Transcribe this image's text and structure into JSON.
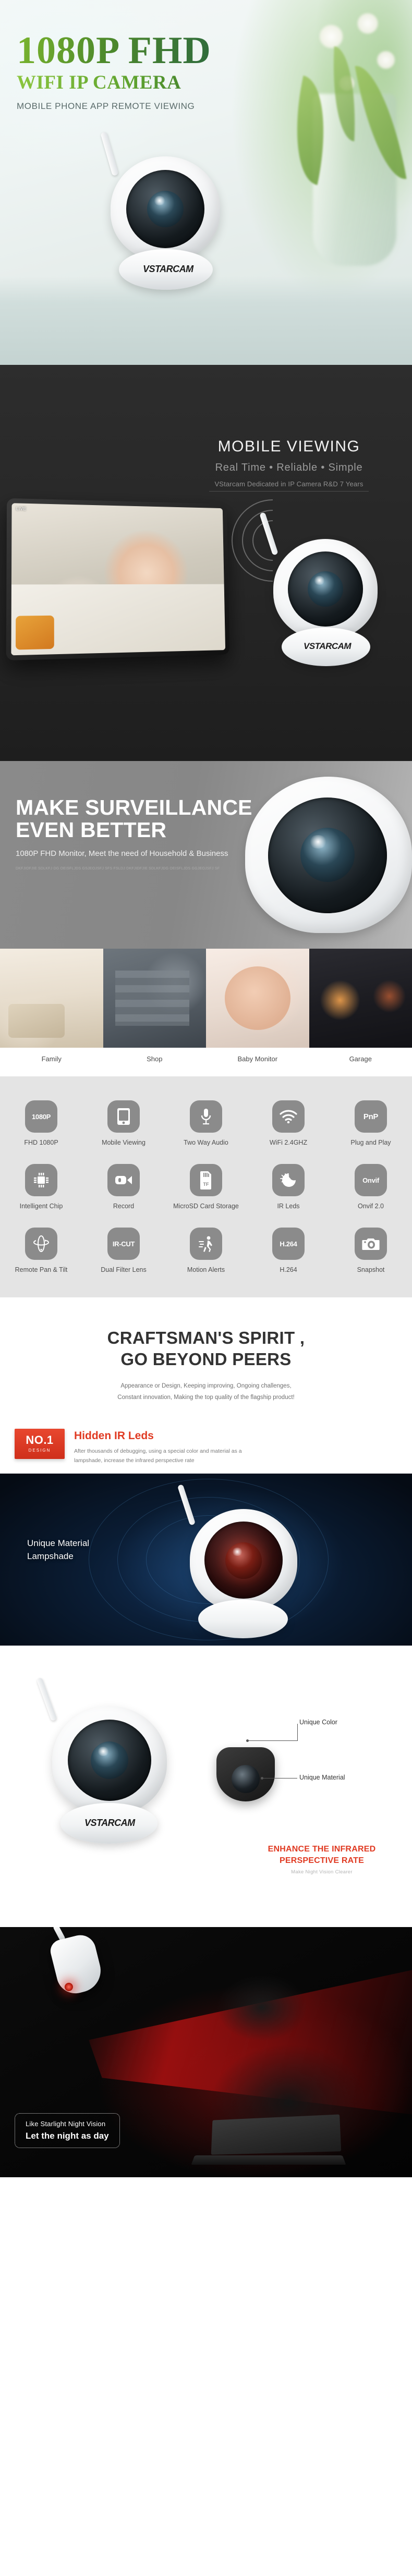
{
  "hero": {
    "title": "1080P FHD",
    "subtitle": "WIFI IP CAMERA",
    "tagline": "MOBILE PHONE APP REMOTE VIEWING",
    "brand": "VSTARCAM",
    "accent_green_light": "#8cc63f",
    "accent_green_dark": "#2f6b3c"
  },
  "mobile_viewing": {
    "title": "MOBILE VIEWING",
    "subtitle": "Real Time • Reliable • Simple",
    "note": "VStarcam Dedicated in IP Camera R&D 7 Years",
    "osd_text": "LIVE",
    "brand": "VSTARCAM"
  },
  "surveillance": {
    "title_line1": "MAKE SURVEILLANCE",
    "title_line2": "EVEN BETTER",
    "subtitle": "1080P FHD Monitor, Meet the need of Household & Business",
    "micro_text": "DKFJIDFJIE SDLKFJ DG OEISFLJDS GSJEOJSFJ SFS FSLDJ DKFJIDFJIE SDLKFJDG OEISFLJDS GGJEOJSFJ SF"
  },
  "scenes": {
    "captions": [
      "Family",
      "Shop",
      "Baby Monitor",
      "Garage"
    ]
  },
  "features": {
    "rows": [
      [
        {
          "icon": "fhd-1080p-icon",
          "glyph": "1080P",
          "label": "FHD 1080P"
        },
        {
          "icon": "mobile-phone-icon",
          "glyph": "phone",
          "label": "Mobile Viewing"
        },
        {
          "icon": "microphone-icon",
          "glyph": "mic",
          "label": "Two Way Audio"
        },
        {
          "icon": "wifi-icon",
          "glyph": "wifi",
          "label": "WiFi 2.4GHZ"
        },
        {
          "icon": "plug-and-play-icon",
          "glyph": "PnP",
          "label": "Plug and Play"
        }
      ],
      [
        {
          "icon": "chip-icon",
          "glyph": "chip",
          "label": "Intelligent Chip"
        },
        {
          "icon": "video-record-icon",
          "glyph": "camcorder",
          "label": "Record"
        },
        {
          "icon": "microsd-card-icon",
          "glyph": "TF",
          "label": "MicroSD Card Storage"
        },
        {
          "icon": "sun-moon-ir-icon",
          "glyph": "sunmoon",
          "label": "IR Leds"
        },
        {
          "icon": "onvif-icon",
          "glyph": "Onvif",
          "label": "Onvif 2.0"
        }
      ],
      [
        {
          "icon": "pan-tilt-icon",
          "glyph": "pantilt",
          "label": "Remote Pan & Tilt"
        },
        {
          "icon": "ir-cut-icon",
          "glyph": "IR-CUT",
          "label": "Dual Filter Lens"
        },
        {
          "icon": "motion-alert-icon",
          "glyph": "runner",
          "label": "Motion Alerts"
        },
        {
          "icon": "h264-codec-icon",
          "glyph": "H.264",
          "label": "H.264"
        },
        {
          "icon": "snapshot-camera-icon",
          "glyph": "camera",
          "label": "Snapshot"
        }
      ]
    ]
  },
  "craftsman": {
    "title_line1": "CRAFTSMAN'S SPIRIT ,",
    "title_line2": "GO BEYOND PEERS",
    "paragraph_line1": "Appearance or Design, Keeping improving, Ongoing challenges,",
    "paragraph_line2": "Constant innovation, Making the top quality of the flagship product!"
  },
  "hidden_ir": {
    "badge_number": "NO.1",
    "badge_sub": "DESIGN",
    "heading": "Hidden IR Leds",
    "paragraph_line1": "After thousands of debugging, using a special color and material as a",
    "paragraph_line2": "lampshade, increase the infrared perspective rate",
    "stage_label_line1": "Unique Material",
    "stage_label_line2": "Lampshade"
  },
  "unique": {
    "callout_color": "Unique Color",
    "callout_material": "Unique Material",
    "enhance_line1": "ENHANCE THE INFRARED",
    "enhance_line2": "PERSPECTIVE RATE",
    "enhance_sub": "Make Night Vision Clearer",
    "accent_red": "#e03a22"
  },
  "night": {
    "badge_line1": "Like Starlight Night Vision",
    "badge_line2": "Let the night as day"
  }
}
